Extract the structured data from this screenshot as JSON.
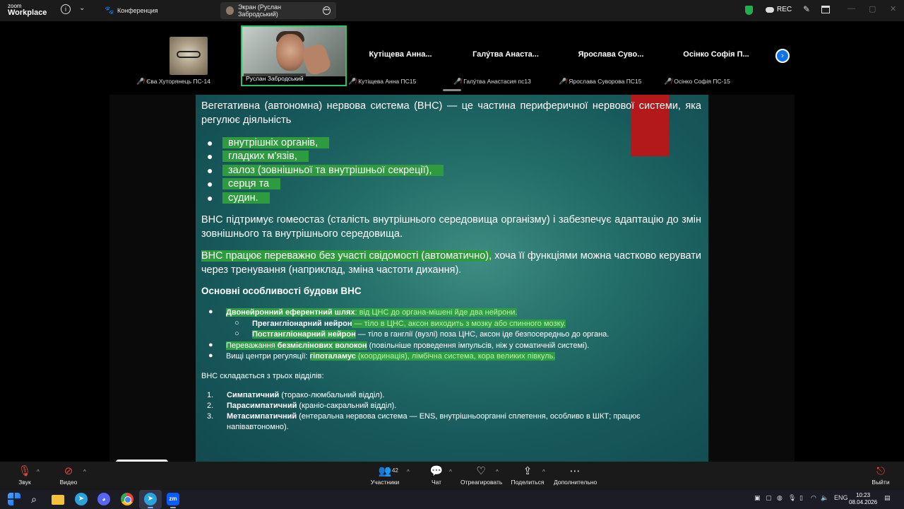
{
  "titlebar": {
    "logo_top": "zoom",
    "logo_bottom": "Workplace",
    "tab_conference": "Конференция",
    "tab_screen": "Экран (Руслан Забродський)",
    "rec": "REC"
  },
  "participants": [
    {
      "tile_name": "",
      "label": "Єва Хуторянець ПС-14"
    },
    {
      "tile_name": "",
      "label": "Руслан Забродський"
    },
    {
      "tile_name": "Кутіщева Анна...",
      "label": "Кутіщева Анна ПС15"
    },
    {
      "tile_name": "Галу́тва Анаста...",
      "label": "Галу́тва Анастасия пс13"
    },
    {
      "tile_name": "Ярослава Суво...",
      "label": "Ярослава Суворова ПС15"
    },
    {
      "tile_name": "Осінко Софія П...",
      "label": "Осінко Софія ПС-15"
    }
  ],
  "slide": {
    "p1": "Вегетативна (автономна) нервова система (ВНС) — це частина периферичної нервової системи, яка регулює діяльність",
    "bullets1": [
      "внутрішніх органів,",
      "гладких м'язів,",
      "залоз (зовнішньої та внутрішньої секреції),",
      "серця та",
      "судин."
    ],
    "p2": "ВНС підтримує гомеостаз (сталість внутрішнього середовища організму) і забезпечує адаптацію до змін зовнішнього та внутрішнього середовища.",
    "p3_hl": "ВНС працює переважно без участі свідомості (автоматично),",
    "p3_rest": " хоча її функціями можна частково керувати через тренування (наприклад, зміна частоти дихання).",
    "heading": "Основні особливості будови ВНС",
    "f1_bold": "Двонейронний еферентний шлях",
    "f1_rest": ": від ЦНС до органа-мішені йде два нейрони.",
    "f2_bold": "Прегангліонарний нейрон",
    "f2_rest": " — тіло в ЦНС, аксон виходить з мозку або спинного мозку.",
    "f3_bold": "Постгангліонарний нейрон",
    "f3_rest": " — тіло в ганглії (вузлі) поза ЦНС, аксон іде безпосередньо до органа.",
    "f4_pre": "Переважання ",
    "f4_bold": "безмієлінових волокон",
    "f4_rest": " (повільніше проведення імпульсів, ніж у соматичній системі).",
    "f5_pre": "Вищі центри регуляції: ",
    "f5_bold": "гіпоталамус",
    "f5_rest": " (координація), лімбічна система, кора великих півкуль.",
    "intro": "ВНС складається з трьох відділів:",
    "n1_num": "1.",
    "n1_bold": "Симпатичний",
    "n1_rest": " (торако-люмбальний відділ).",
    "n2_num": "2.",
    "n2_bold": "Парасимпатичний",
    "n2_rest": " (краніо-сакральний відділ).",
    "n3_num": "3.",
    "n3_bold": "Метасимпатичний",
    "n3_rest": " (ентеральна нервова система — ENS, внутрішньоорганні сплетення, особливо в ШКТ; працює",
    "n3_cont": "напівавтономно)."
  },
  "meeting_bar": {
    "audio": "Звук",
    "video": "Видео",
    "participants": "Участники",
    "participants_count": "42",
    "chat": "Чат",
    "react": "Отреагировать",
    "share": "Поделиться",
    "more": "Дополнительно",
    "leave": "Выйти"
  },
  "taskbar": {
    "lang": "ENG",
    "time": "10:23",
    "date": "08.04.2026"
  },
  "colors": {
    "highlight": "#2e9b3f",
    "active_speaker_border": "#28c466",
    "red_bar": "#b3191b",
    "zoom_blue": "#0e72ed"
  }
}
